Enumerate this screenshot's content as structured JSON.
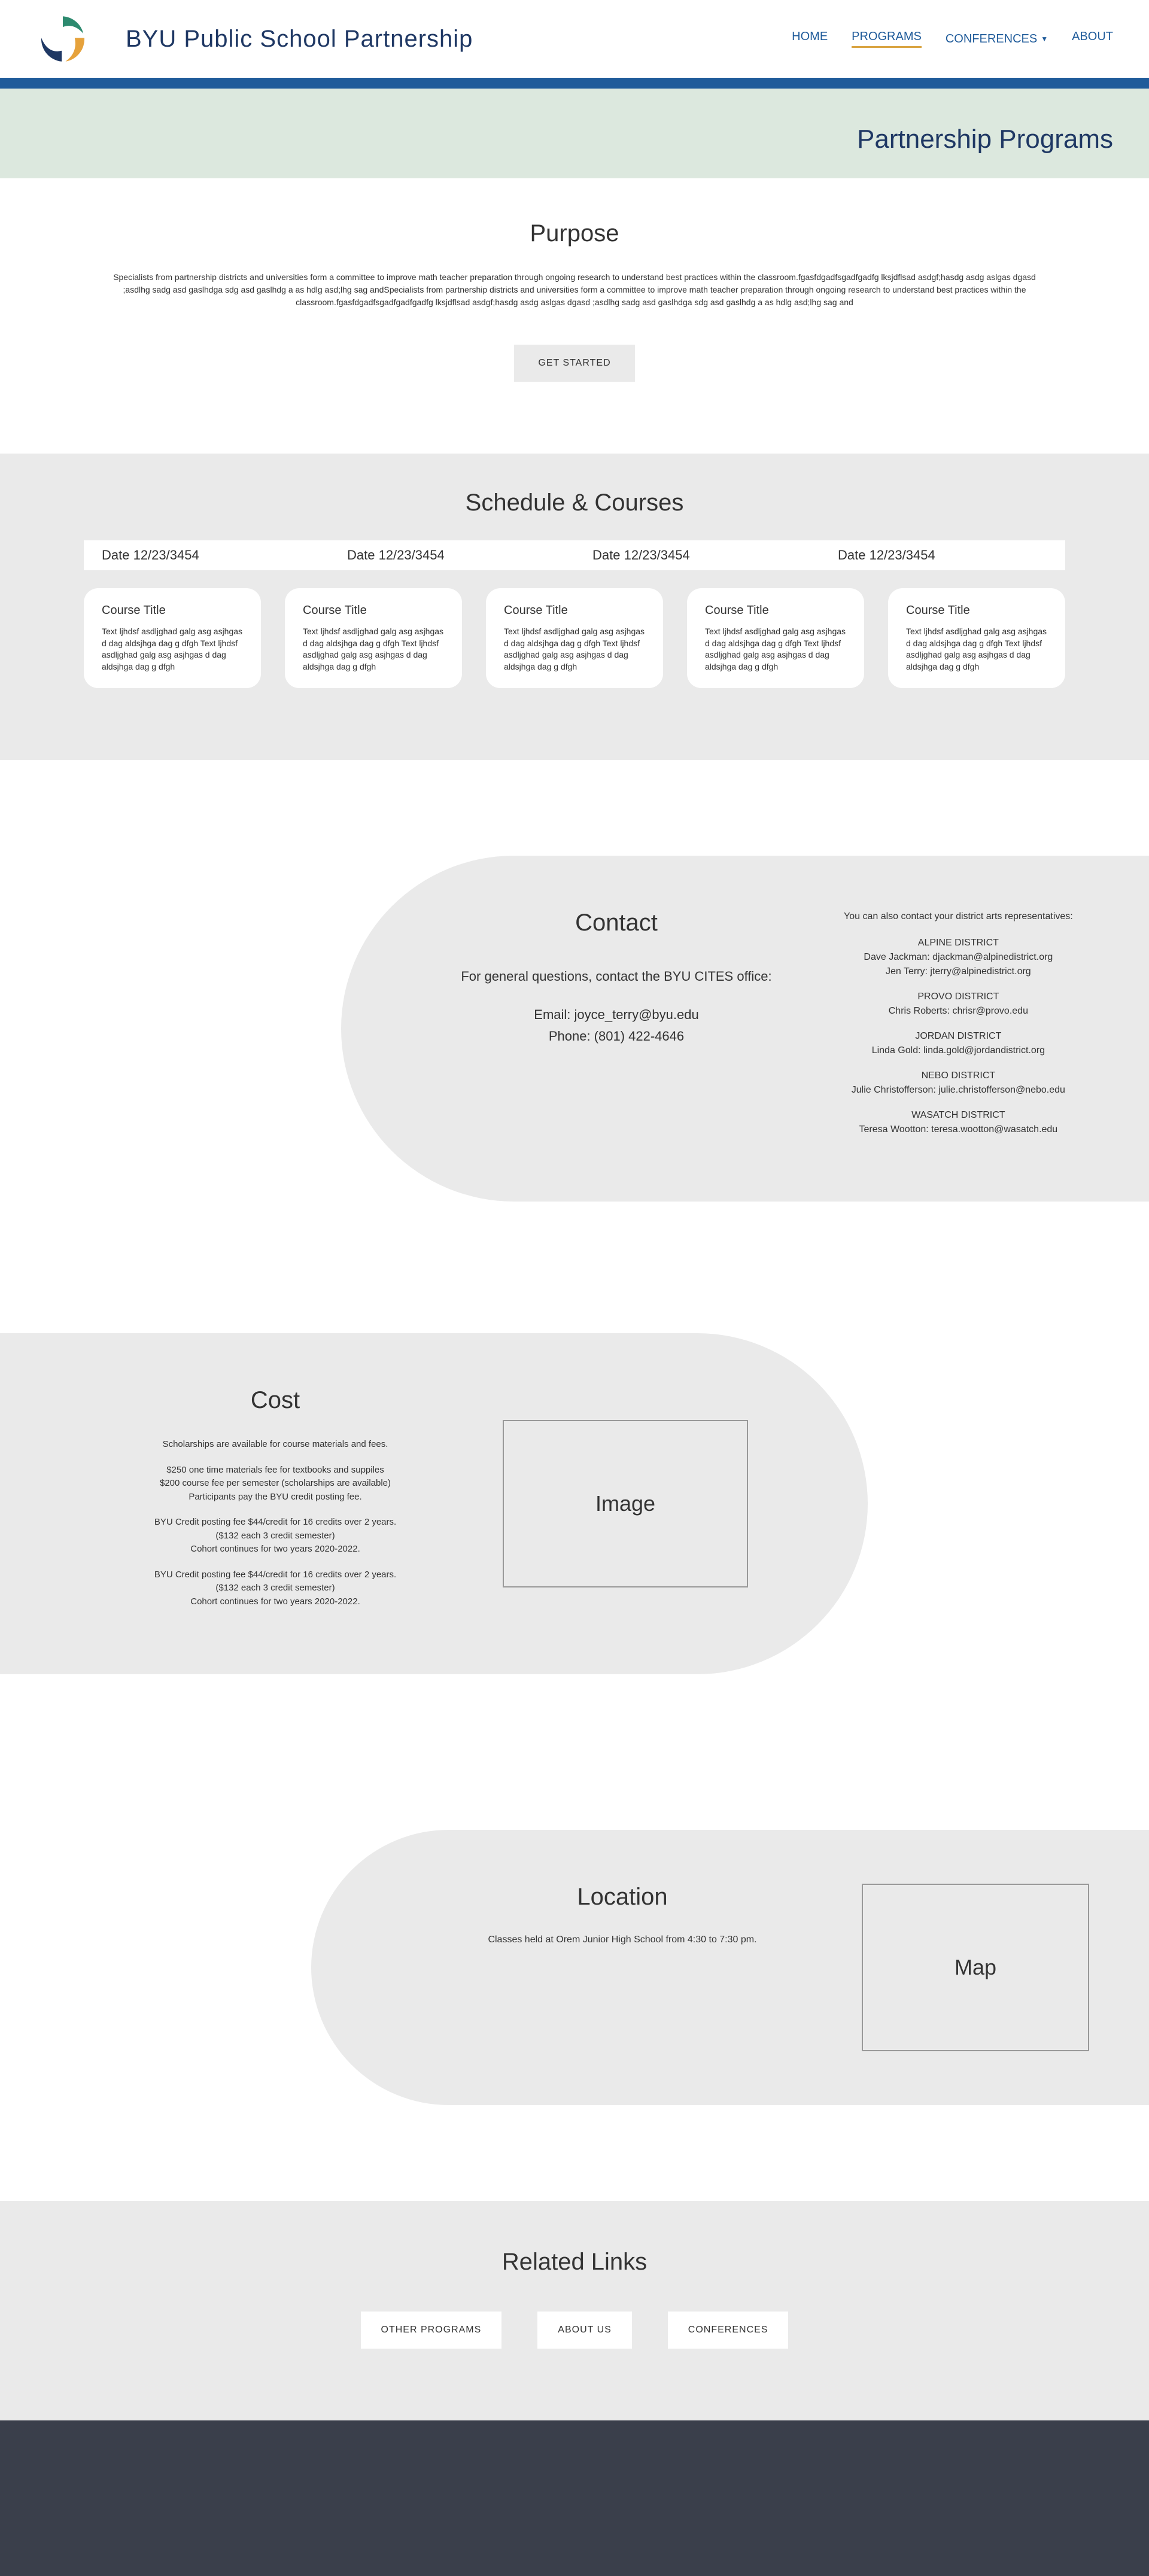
{
  "header": {
    "site_title": "BYU Public School Partnership",
    "nav": {
      "home": "HOME",
      "programs": "PROGRAMS",
      "conferences": "CONFERENCES",
      "about": "ABOUT"
    }
  },
  "hero": {
    "title": "Partnership Programs"
  },
  "purpose": {
    "heading": "Purpose",
    "body": "Specialists from partnership districts and universities form a committee to improve math teacher preparation through ongoing research to understand best practices within the classroom.fgasfdgadfsgadfgadfg lksjdflsad asdgf;hasdg asdg aslgas dgasd ;asdlhg sadg asd gaslhdga sdg asd gaslhdg a as hdlg asd;lhg sag andSpecialists from partnership districts and universities form a committee to improve math teacher preparation through ongoing research to understand best practices within the classroom.fgasfdgadfsgadfgadfgadfg lksjdflsad asdgf;hasdg asdg aslgas dgasd ;asdlhg sadg asd gaslhdga sdg asd gaslhdg a as hdlg asd;lhg sag and",
    "btn": "GET STARTED"
  },
  "schedule": {
    "heading": "Schedule & Courses",
    "dates": [
      "Date 12/23/3454",
      "Date 12/23/3454",
      "Date 12/23/3454",
      "Date 12/23/3454"
    ],
    "cards": [
      {
        "title": "Course Title",
        "desc": "Text ljhdsf asdljghad galg asg asjhgas d dag aldsjhga dag g dfgh Text ljhdsf asdljghad galg asg asjhgas d dag aldsjhga dag g dfgh"
      },
      {
        "title": "Course Title",
        "desc": "Text ljhdsf asdljghad galg asg asjhgas d dag aldsjhga dag g dfgh Text ljhdsf asdljghad galg asg asjhgas d dag aldsjhga dag g dfgh"
      },
      {
        "title": "Course Title",
        "desc": "Text ljhdsf asdljghad galg asg asjhgas d dag aldsjhga dag g dfgh Text ljhdsf asdljghad galg asg asjhgas d dag aldsjhga dag g dfgh"
      },
      {
        "title": "Course Title",
        "desc": "Text ljhdsf asdljghad galg asg asjhgas d dag aldsjhga dag g dfgh Text ljhdsf asdljghad galg asg asjhgas d dag aldsjhga dag g dfgh"
      },
      {
        "title": "Course Title",
        "desc": "Text ljhdsf asdljghad galg asg asjhgas d dag aldsjhga dag g dfgh Text ljhdsf asdljghad galg asg asjhgas d dag aldsjhga dag g dfgh"
      }
    ]
  },
  "contact": {
    "heading": "Contact",
    "intro": "For general questions, contact the BYU CITES office:",
    "email_line": "Email: joyce_terry@byu.edu",
    "phone_line": "Phone: (801) 422-4646",
    "reps_intro": "You can also contact your district arts representatives:",
    "reps": [
      {
        "district": "ALPINE DISTRICT",
        "lines": [
          "Dave Jackman: djackman@alpinedistrict.org",
          "Jen Terry: jterry@alpinedistrict.org"
        ]
      },
      {
        "district": "PROVO DISTRICT",
        "lines": [
          "Chris Roberts: chrisr@provo.edu"
        ]
      },
      {
        "district": "JORDAN DISTRICT",
        "lines": [
          "Linda Gold: linda.gold@jordandistrict.org"
        ]
      },
      {
        "district": "NEBO DISTRICT",
        "lines": [
          "Julie Christofferson: julie.christofferson@nebo.edu"
        ]
      },
      {
        "district": "WASATCH DISTRICT",
        "lines": [
          "Teresa Wootton: teresa.wootton@wasatch.edu"
        ]
      }
    ]
  },
  "cost": {
    "heading": "Cost",
    "p1": "Scholarships are available for course materials and fees.",
    "p2": "$250 one time materials fee for textbooks and suppiles\n$200 course fee per semester (scholarships are available)\nParticipants pay the BYU credit posting fee.",
    "p3": "BYU Credit posting fee $44/credit for 16 credits over 2 years.\n($132 each 3 credit semester)\nCohort continues for two years 2020-2022.",
    "p4": "BYU Credit posting fee $44/credit for 16 credits over 2 years.\n($132 each 3 credit semester)\nCohort continues for two years 2020-2022.",
    "img": "Image"
  },
  "location": {
    "heading": "Location",
    "body": "Classes held at Orem Junior High School from 4:30 to 7:30 pm.",
    "map": "Map"
  },
  "related": {
    "heading": "Related Links",
    "btns": [
      "OTHER PROGRAMS",
      "ABOUT US",
      "CONFERENCES"
    ]
  }
}
